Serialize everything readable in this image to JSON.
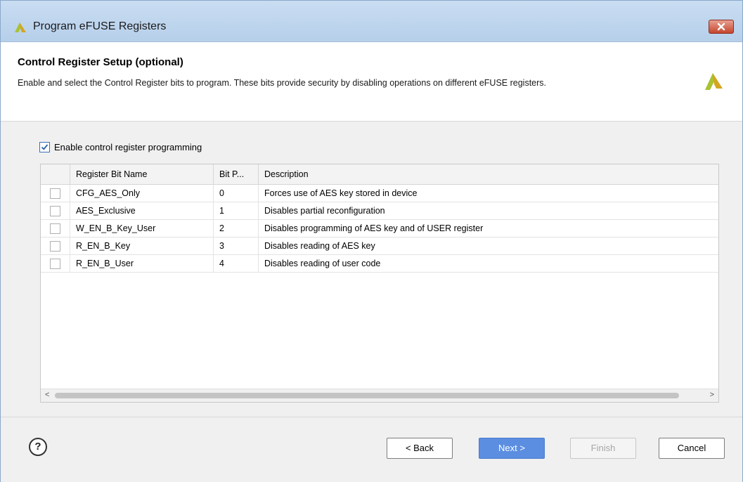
{
  "window": {
    "title": "Program eFUSE Registers"
  },
  "header": {
    "title": "Control Register Setup (optional)",
    "description": "Enable and select the Control Register bits to program. These bits provide security by disabling operations on different eFUSE registers."
  },
  "enable": {
    "label": "Enable control register programming",
    "checked": true
  },
  "table": {
    "columns": [
      "",
      "Register Bit Name",
      "Bit P...",
      "Description"
    ],
    "rows": [
      {
        "checked": false,
        "name": "CFG_AES_Only",
        "bit": "0",
        "description": "Forces use of AES key stored in device"
      },
      {
        "checked": false,
        "name": "AES_Exclusive",
        "bit": "1",
        "description": "Disables partial reconfiguration"
      },
      {
        "checked": false,
        "name": "W_EN_B_Key_User",
        "bit": "2",
        "description": "Disables programming of AES key and of USER register"
      },
      {
        "checked": false,
        "name": "R_EN_B_Key",
        "bit": "3",
        "description": "Disables reading of AES key"
      },
      {
        "checked": false,
        "name": "R_EN_B_User",
        "bit": "4",
        "description": "Disables reading of user code"
      }
    ]
  },
  "scrollbar": {
    "left_arrow": "<",
    "right_arrow": ">"
  },
  "footer": {
    "help": "?",
    "back": "< Back",
    "next": "Next >",
    "finish": "Finish",
    "cancel": "Cancel"
  },
  "colors": {
    "accent": "#5b8ee0",
    "logo": "#a8c232",
    "title_bar": "#c9ddf2",
    "close": "#c6452e"
  },
  "icons": {
    "app_logo": "xilinx-logo-icon",
    "close": "close-icon",
    "help": "help-icon"
  }
}
